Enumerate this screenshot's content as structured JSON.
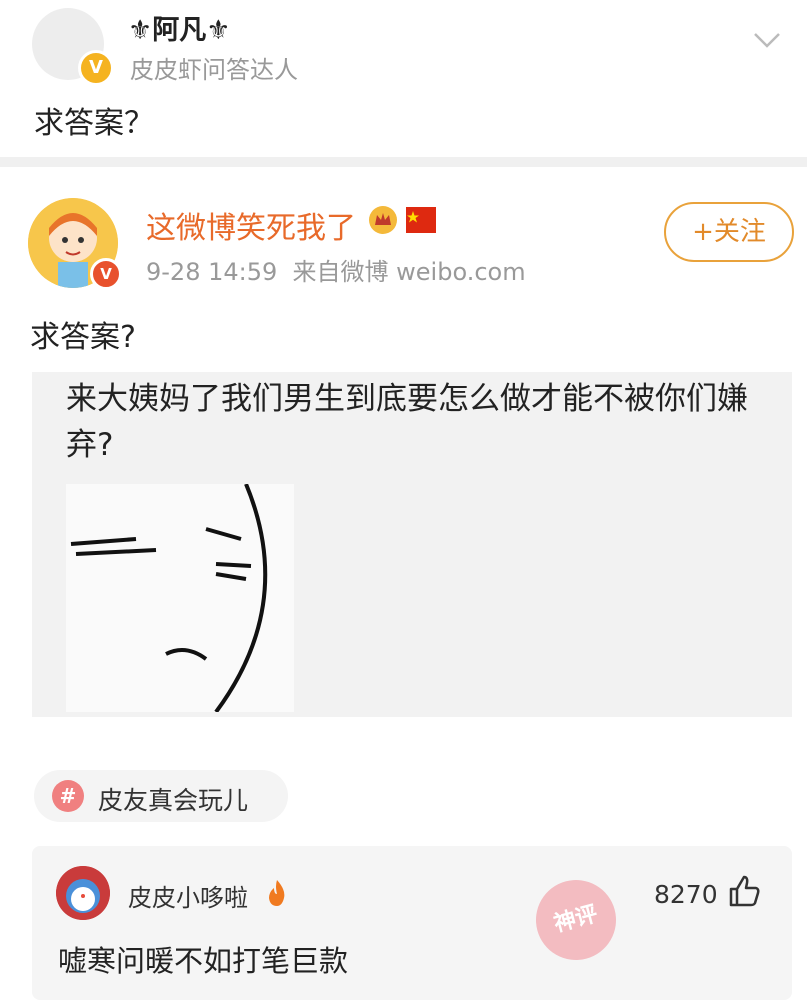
{
  "question_post": {
    "author_name": "⚜阿凡⚜",
    "author_role": "皮皮虾问答达人",
    "question": "求答案？"
  },
  "weibo_post": {
    "author_name": "这微博笑死我了",
    "timestamp": "9-28 14:59",
    "source": "来自微博 weibo.com",
    "follow_label": "+关注",
    "text": "求答案?",
    "image_text": "来大姨妈了我们男生到底要怎么做才能不被你们嫌弃?"
  },
  "topic": {
    "label": "皮友真会玩儿"
  },
  "comment": {
    "username": "皮皮小哆啦",
    "likes": "8270",
    "text": "嘘寒问暖不如打笔巨款"
  },
  "stamp_text": "神评",
  "colors": {
    "accent_orange": "#e86a2a",
    "follow_border": "#e9a23b",
    "verified_gold": "#f5b320",
    "topic_icon": "#f08080"
  },
  "icons": [
    "verified-badge-icon",
    "chevron-down-icon",
    "crown-icon",
    "china-flag-icon",
    "hash-icon",
    "fire-icon",
    "thumb-up-icon"
  ]
}
